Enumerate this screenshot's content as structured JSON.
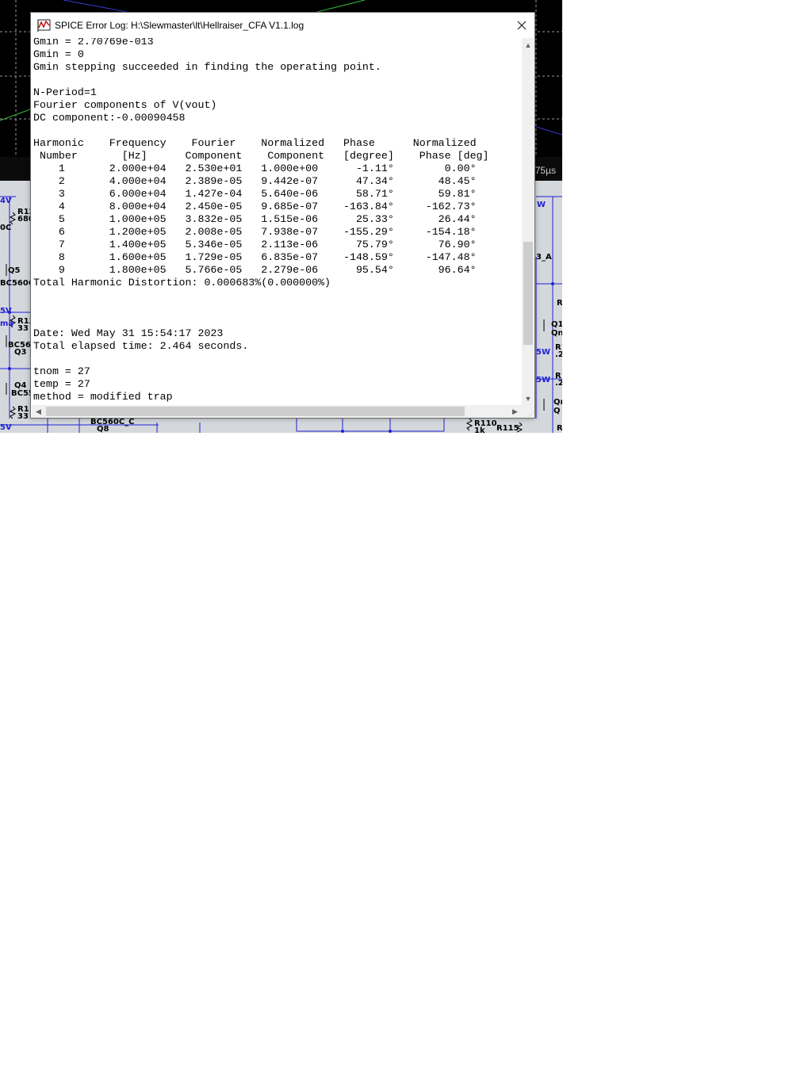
{
  "window": {
    "title": "SPICE Error Log: H:\\Slewmaster\\lt\\Hellraiser_CFA V1.1.log",
    "close_glyph": "✕",
    "icon": "ltspice-icon"
  },
  "log": {
    "lines": [
      "Gmin = 2.70769e-013",
      "Gmin = 0",
      "Gmin stepping succeeded in finding the operating point.",
      "",
      "N-Period=1",
      "Fourier components of V(vout)",
      "DC component:-0.00090458",
      "",
      "Harmonic    Frequency    Fourier    Normalized   Phase      Normalized",
      " Number       [Hz]      Component    Component   [degree]    Phase [deg]",
      "    1       2.000e+04   2.530e+01   1.000e+00      -1.11°        0.00°",
      "    2       4.000e+04   2.389e-05   9.442e-07      47.34°       48.45°",
      "    3       6.000e+04   1.427e-04   5.640e-06      58.71°       59.81°",
      "    4       8.000e+04   2.450e-05   9.685e-07    -163.84°     -162.73°",
      "    5       1.000e+05   3.832e-05   1.515e-06      25.33°       26.44°",
      "    6       1.200e+05   2.008e-05   7.938e-07    -155.29°     -154.18°",
      "    7       1.400e+05   5.346e-05   2.113e-06      75.79°       76.90°",
      "    8       1.600e+05   1.729e-05   6.835e-07    -148.59°     -147.48°",
      "    9       1.800e+05   5.766e-05   2.279e-06      95.54°       96.64°",
      "Total Harmonic Distortion: 0.000683%(0.000000%)",
      "",
      "",
      "",
      "Date: Wed May 31 15:54:17 2023",
      "Total elapsed time: 2.464 seconds.",
      "",
      "tnom = 27",
      "temp = 27",
      "method = modified trap"
    ]
  },
  "scrollbars": {
    "up": "▲",
    "down": "▼",
    "left": "◀",
    "right": "▶",
    "grip": "⋰"
  },
  "background": {
    "time_axis_label": "75µs",
    "schematic_labels": [
      "4V",
      "R12",
      "680",
      "0C",
      "Q5",
      "BC560C",
      "5V",
      "ma",
      "R13",
      "33",
      "BC56",
      "Q3",
      "Q4",
      "BC55",
      "R1",
      "33",
      "5V",
      "BC560C_C",
      "Q8",
      "R110",
      "1k",
      "R115",
      "W",
      "3_A",
      "R",
      "Q1",
      "Qn",
      "5W",
      "R1",
      ".2",
      "5W",
      "R1",
      ".2",
      "Qn",
      "Q",
      "R"
    ]
  }
}
